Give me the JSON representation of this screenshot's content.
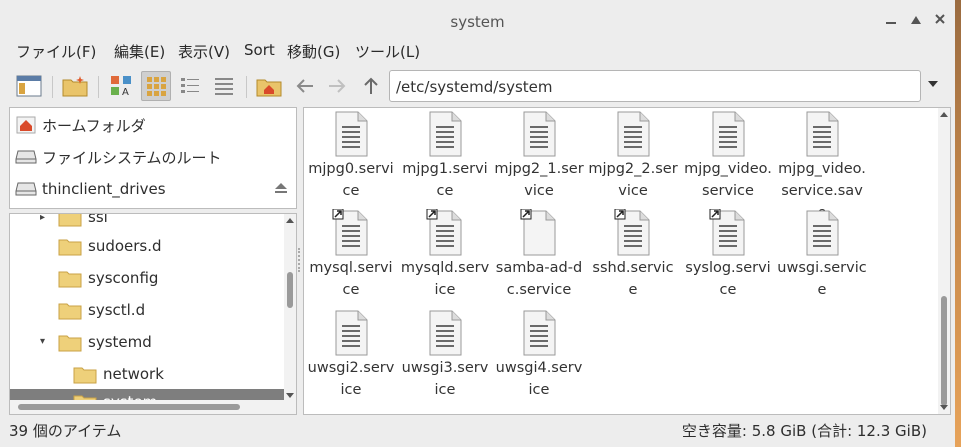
{
  "window": {
    "title": "system"
  },
  "menu": [
    "ファイル(F)",
    "編集(E)",
    "表示(V)",
    "Sort",
    "移動(G)",
    "ツール(L)"
  ],
  "path": {
    "value": "/etc/systemd/system"
  },
  "places": [
    {
      "label": "ホームフォルダ",
      "icon": "home-icon"
    },
    {
      "label": "ファイルシステムのルート",
      "icon": "drive-icon"
    },
    {
      "label": "thinclient_drives",
      "icon": "drive-icon"
    }
  ],
  "tree": [
    {
      "label": "ssl",
      "expander": "collapsed"
    },
    {
      "label": "sudoers.d"
    },
    {
      "label": "sysconfig"
    },
    {
      "label": "sysctl.d"
    },
    {
      "label": "systemd",
      "expander": "expanded"
    },
    {
      "label": "network"
    },
    {
      "label": "system"
    }
  ],
  "files": [
    {
      "name": "mjpg0.service",
      "type": "text",
      "link": false
    },
    {
      "name": "mjpg1.service",
      "type": "text",
      "link": false
    },
    {
      "name": "mjpg2_1.service",
      "type": "text",
      "link": false
    },
    {
      "name": "mjpg2_2.service",
      "type": "text",
      "link": false
    },
    {
      "name": "mjpg_video.service",
      "type": "text",
      "link": false
    },
    {
      "name": "mjpg_video.service.save",
      "type": "text",
      "link": false
    },
    {
      "name": "mysql.service",
      "type": "text",
      "link": true
    },
    {
      "name": "mysqld.service",
      "type": "text",
      "link": true
    },
    {
      "name": "samba-ad-dc.service",
      "type": "blank",
      "link": true
    },
    {
      "name": "sshd.service",
      "type": "text",
      "link": true
    },
    {
      "name": "syslog.service",
      "type": "text",
      "link": true
    },
    {
      "name": "uwsgi.service",
      "type": "text",
      "link": false
    },
    {
      "name": "uwsgi2.service",
      "type": "text",
      "link": false
    },
    {
      "name": "uwsgi3.service",
      "type": "text",
      "link": false
    },
    {
      "name": "uwsgi4.service",
      "type": "text",
      "link": false
    }
  ],
  "status": {
    "count": "39 個のアイテム",
    "space": "空き容量: 5.8 GiB (合計: 12.3 GiB)"
  }
}
